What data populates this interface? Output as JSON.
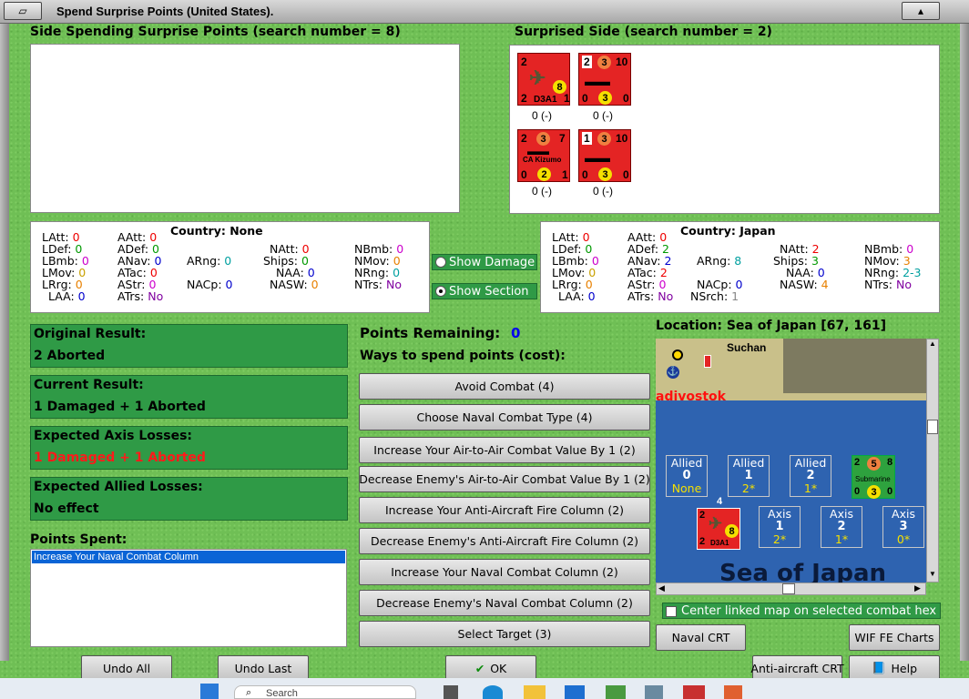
{
  "window": {
    "title": "Spend Surprise Points (United States)."
  },
  "sides": {
    "spending_label": "Side Spending Surprise Points (search number = 8)",
    "surprised_label": "Surprised Side (search number = 2)"
  },
  "counters": [
    {
      "tl": "2",
      "tr": "",
      "type": "D3A1",
      "bl": "2",
      "br": "1",
      "center": "8",
      "label": "0 (-)"
    },
    {
      "tl": "2",
      "mid": "3",
      "tr": "10",
      "bl": "0",
      "center": "3",
      "br": "0",
      "label": "0 (-)"
    },
    {
      "tl": "2",
      "mid": "3",
      "tr": "7",
      "type": "CA Kizumo",
      "bl": "0",
      "center": "2",
      "br": "1",
      "label": "0 (-)"
    },
    {
      "tl": "1",
      "mid": "3",
      "tr": "10",
      "bl": "0",
      "center": "3",
      "br": "0",
      "label": "0 (-)"
    }
  ],
  "left_stats": {
    "country": "Country: None",
    "items": [
      [
        "LAtt:",
        "0"
      ],
      [
        "LDef:",
        "0"
      ],
      [
        "LBmb:",
        "0"
      ],
      [
        "LMov:",
        "0"
      ],
      [
        "LRrg:",
        "0"
      ],
      [
        "LAA:",
        "0"
      ],
      [
        "AAtt:",
        "0"
      ],
      [
        "ADef:",
        "0"
      ],
      [
        "ANav:",
        "0"
      ],
      [
        "ATac:",
        "0"
      ],
      [
        "AStr:",
        "0"
      ],
      [
        "ATrs:",
        "No"
      ],
      [
        "ARng:",
        "0"
      ],
      [
        "NACp:",
        "0"
      ],
      [
        "NAtt:",
        "0"
      ],
      [
        "Ships:",
        "0"
      ],
      [
        "NAA:",
        "0"
      ],
      [
        "NASW:",
        "0"
      ],
      [
        "NBmb:",
        "0"
      ],
      [
        "NMov:",
        "0"
      ],
      [
        "NRng:",
        "0"
      ],
      [
        "NTrs:",
        "No"
      ]
    ]
  },
  "right_stats": {
    "country": "Country: Japan",
    "items": [
      [
        "LAtt:",
        "0"
      ],
      [
        "LDef:",
        "0"
      ],
      [
        "LBmb:",
        "0"
      ],
      [
        "LMov:",
        "0"
      ],
      [
        "LRrg:",
        "0"
      ],
      [
        "LAA:",
        "0"
      ],
      [
        "AAtt:",
        "0"
      ],
      [
        "ADef:",
        "2"
      ],
      [
        "ANav:",
        "2"
      ],
      [
        "ATac:",
        "2"
      ],
      [
        "AStr:",
        "0"
      ],
      [
        "ATrs:",
        "No"
      ],
      [
        "ARng:",
        "8"
      ],
      [
        "NACp:",
        "0"
      ],
      [
        "NSrch:",
        "1"
      ],
      [
        "NAtt:",
        "2"
      ],
      [
        "Ships:",
        "3"
      ],
      [
        "NAA:",
        "0"
      ],
      [
        "NASW:",
        "4"
      ],
      [
        "NBmb:",
        "0"
      ],
      [
        "NMov:",
        "3"
      ],
      [
        "NRng:",
        "2-3"
      ],
      [
        "NTrs:",
        "No"
      ]
    ]
  },
  "options": {
    "show_damage": "Show Damage",
    "show_section": "Show Section"
  },
  "results": {
    "original_h": "Original Result:",
    "original_v": "2 Aborted",
    "current_h": "Current Result:",
    "current_v": "1 Damaged + 1 Aborted",
    "axis_h": "Expected Axis Losses:",
    "axis_v": "1 Damaged + 1 Aborted",
    "allied_h": "Expected Allied Losses:",
    "allied_v": "No effect"
  },
  "points": {
    "spent_label": "Points Spent:",
    "spent_items": [
      "Increase Your Naval Combat Column"
    ],
    "remaining_label": "Points Remaining:",
    "remaining_value": "0",
    "ways_label": "Ways to spend points (cost):"
  },
  "ways": [
    "Avoid Combat (4)",
    "Choose Naval Combat Type (4)",
    "Increase Your Air-to-Air Combat Value By 1 (2)",
    "Decrease Enemy's Air-to-Air Combat Value By 1 (2)",
    "Increase Your Anti-Aircraft Fire Column (2)",
    "Decrease Enemy's Anti-Aircraft Fire Column (2)",
    "Increase Your Naval Combat Column (2)",
    "Decrease Enemy's Naval Combat Column (2)",
    "Select Target (3)"
  ],
  "map": {
    "location": "Location: Sea of Japan [67, 161]",
    "city1": "Suchan",
    "city2": "adivostok",
    "sea": "Sea of Japan",
    "allied": [
      {
        "h": "Allied",
        "n": "0",
        "v": "None"
      },
      {
        "h": "Allied",
        "n": "1",
        "v": "2*"
      },
      {
        "h": "Allied",
        "n": "2",
        "v": "1*"
      }
    ],
    "axis": [
      {
        "h": "Axis",
        "n": "1",
        "v": "2*"
      },
      {
        "h": "Axis",
        "n": "2",
        "v": "1*"
      },
      {
        "h": "Axis",
        "n": "3",
        "v": "0*"
      }
    ],
    "sub": {
      "tl": "2",
      "mid": "5",
      "tr": "8",
      "type": "Submarine",
      "bl": "0",
      "center": "3",
      "br": "0"
    },
    "d3a1": {
      "stack": "4",
      "tl": "2",
      "type": "D3A1",
      "bl": "2",
      "center": "8"
    },
    "center_linked": "Center linked map on selected combat hex"
  },
  "buttons": {
    "naval_crt": "Naval CRT",
    "wif_fe": "WIF FE Charts",
    "aa_crt": "Anti-aircraft CRT",
    "help": "Help",
    "undo_all": "Undo All",
    "undo_last": "Undo Last",
    "ok": "OK"
  },
  "taskbar": {
    "search": "Search"
  }
}
